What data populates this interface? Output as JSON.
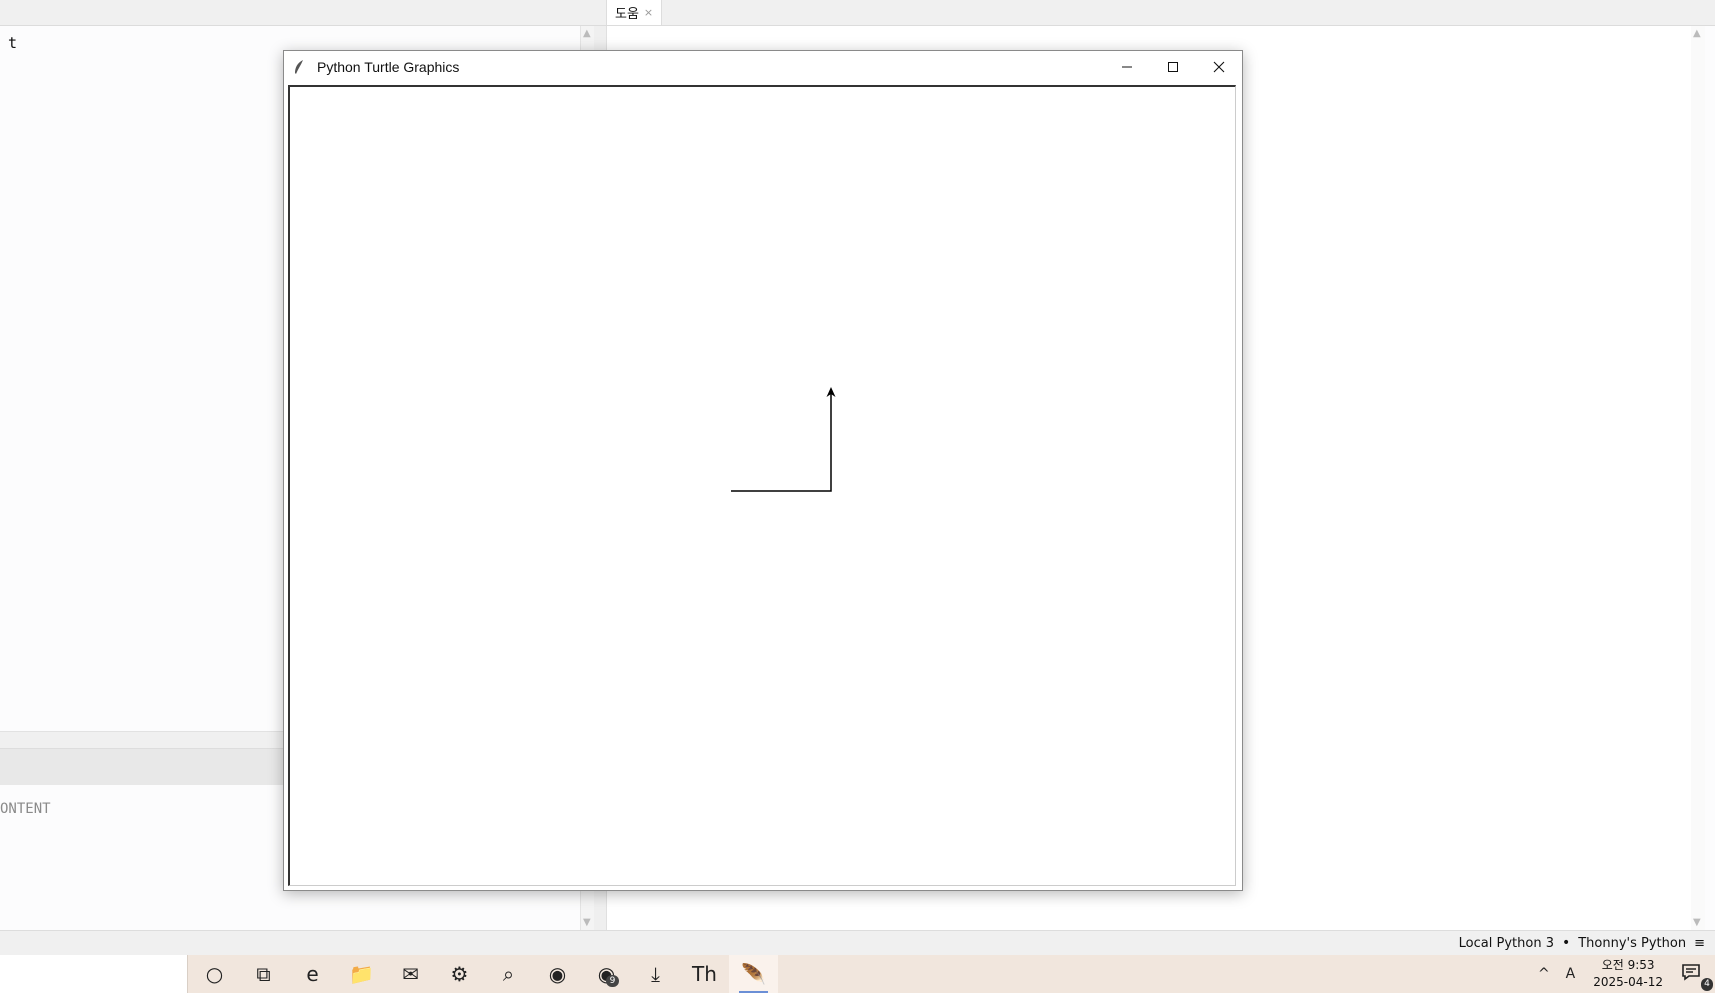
{
  "editor": {
    "code_line": "t",
    "help_tab_label": "도움",
    "help_tab_close": "×",
    "shell_text": "ONTENT"
  },
  "statusbar": {
    "interpreter": "Local Python 3",
    "separator": "•",
    "app": "Thonny's Python",
    "menu_glyph": "≡"
  },
  "turtle_window": {
    "title": "Python Turtle Graphics",
    "path": {
      "stroke": "#000000",
      "heading": "north",
      "points": [
        [
          -100,
          0
        ],
        [
          0,
          0
        ],
        [
          0,
          100
        ]
      ]
    }
  },
  "taskbar": {
    "icons": [
      {
        "name": "cortana-icon",
        "glyph": "○"
      },
      {
        "name": "task-view-icon",
        "glyph": "⧉"
      },
      {
        "name": "edge-icon",
        "glyph": "e"
      },
      {
        "name": "file-explorer-icon",
        "glyph": "📁"
      },
      {
        "name": "mail-icon",
        "glyph": "✉"
      },
      {
        "name": "settings-icon",
        "glyph": "⚙"
      },
      {
        "name": "feedback-icon",
        "glyph": "⌕"
      },
      {
        "name": "chrome-icon",
        "glyph": "◉"
      },
      {
        "name": "chrome-profile-icon",
        "glyph": "◉",
        "badge": "9"
      },
      {
        "name": "downloads-icon",
        "glyph": "⤓"
      },
      {
        "name": "thonny-icon",
        "glyph": "Th"
      },
      {
        "name": "turtle-feather-icon",
        "glyph": "🪶",
        "active": true
      }
    ],
    "tray": {
      "chevron": "^",
      "ime": "A",
      "time": "오전 9:53",
      "date": "2025-04-12",
      "notifications": "4"
    }
  },
  "colors": {
    "taskbar_bg": "#f1e6dd",
    "active_underline": "#6b8fd6"
  }
}
